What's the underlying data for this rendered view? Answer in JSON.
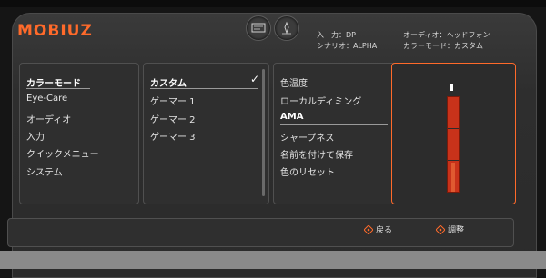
{
  "brand": "MOBIUZ",
  "status": {
    "input_label": "入　力：DP",
    "scenario_label": "シナリオ：ALPHA",
    "audio_label": "オーディオ：ヘッドフォン",
    "color_mode_label": "カラーモード：カスタム"
  },
  "icons": [
    "display-mode-icon",
    "light-tuner-icon"
  ],
  "menu": {
    "main": [
      "カラーモード",
      "Eye-Care",
      "オーディオ",
      "入力",
      "クイックメニュー",
      "システム"
    ],
    "sub": [
      "カスタム",
      "ゲーマー 1",
      "ゲーマー 2",
      "ゲーマー 3"
    ],
    "detail": [
      "色温度",
      "ローカルディミング",
      "AMA",
      "シャープネス",
      "名前を付けて保存",
      "色のリセット"
    ]
  },
  "selected_sub_check": "✓",
  "footer": {
    "back_label": "戻る",
    "adjust_label": "調整"
  },
  "colors": {
    "accent": "#ff6a2a",
    "bar": "#c8321a"
  }
}
